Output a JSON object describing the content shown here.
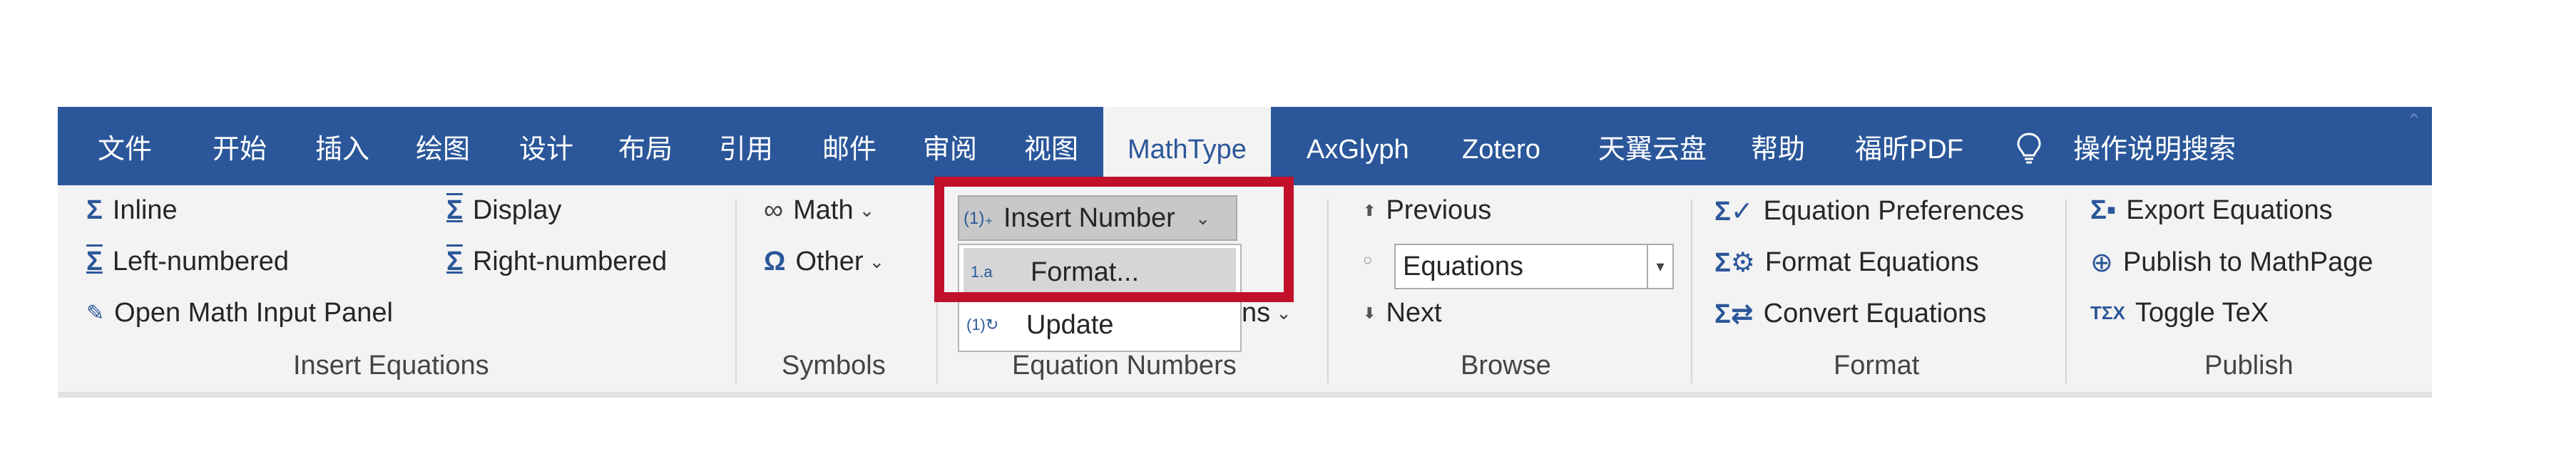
{
  "tabs": [
    {
      "label": "文件"
    },
    {
      "label": "开始"
    },
    {
      "label": "插入"
    },
    {
      "label": "绘图"
    },
    {
      "label": "设计"
    },
    {
      "label": "布局"
    },
    {
      "label": "引用"
    },
    {
      "label": "邮件"
    },
    {
      "label": "审阅"
    },
    {
      "label": "视图"
    },
    {
      "label": "MathType",
      "active": true
    },
    {
      "label": "AxGlyph"
    },
    {
      "label": "Zotero"
    },
    {
      "label": "天翼云盘"
    },
    {
      "label": "帮助"
    },
    {
      "label": "福昕PDF"
    },
    {
      "label": "操作说明搜索"
    }
  ],
  "insert_equations": {
    "inline": "Inline",
    "display": "Display",
    "left_numbered": "Left-numbered",
    "right_numbered": "Right-numbered",
    "open_math_input": "Open Math Input Panel",
    "group_label": "Insert Equations"
  },
  "symbols": {
    "math": "Math",
    "other": "Other",
    "group_label": "Symbols"
  },
  "equation_numbers": {
    "insert_number": "Insert Number",
    "format": "Format...",
    "update": "Update",
    "partial_hidden": "ns",
    "group_label": "Equation Numbers"
  },
  "browse": {
    "previous": "Previous",
    "combo_value": "Equations",
    "next": "Next",
    "group_label": "Browse"
  },
  "format": {
    "preferences": "Equation Preferences",
    "format_equations": "Format Equations",
    "convert": "Convert Equations",
    "group_label": "Format"
  },
  "publish": {
    "export": "Export Equations",
    "mathpage": "Publish to MathPage",
    "toggle_tex": "Toggle TeX",
    "group_label": "Publish"
  },
  "colors": {
    "tab_bar": "#2b579a",
    "ribbon_bg": "#f3f3f3",
    "highlight": "#c0102a"
  }
}
